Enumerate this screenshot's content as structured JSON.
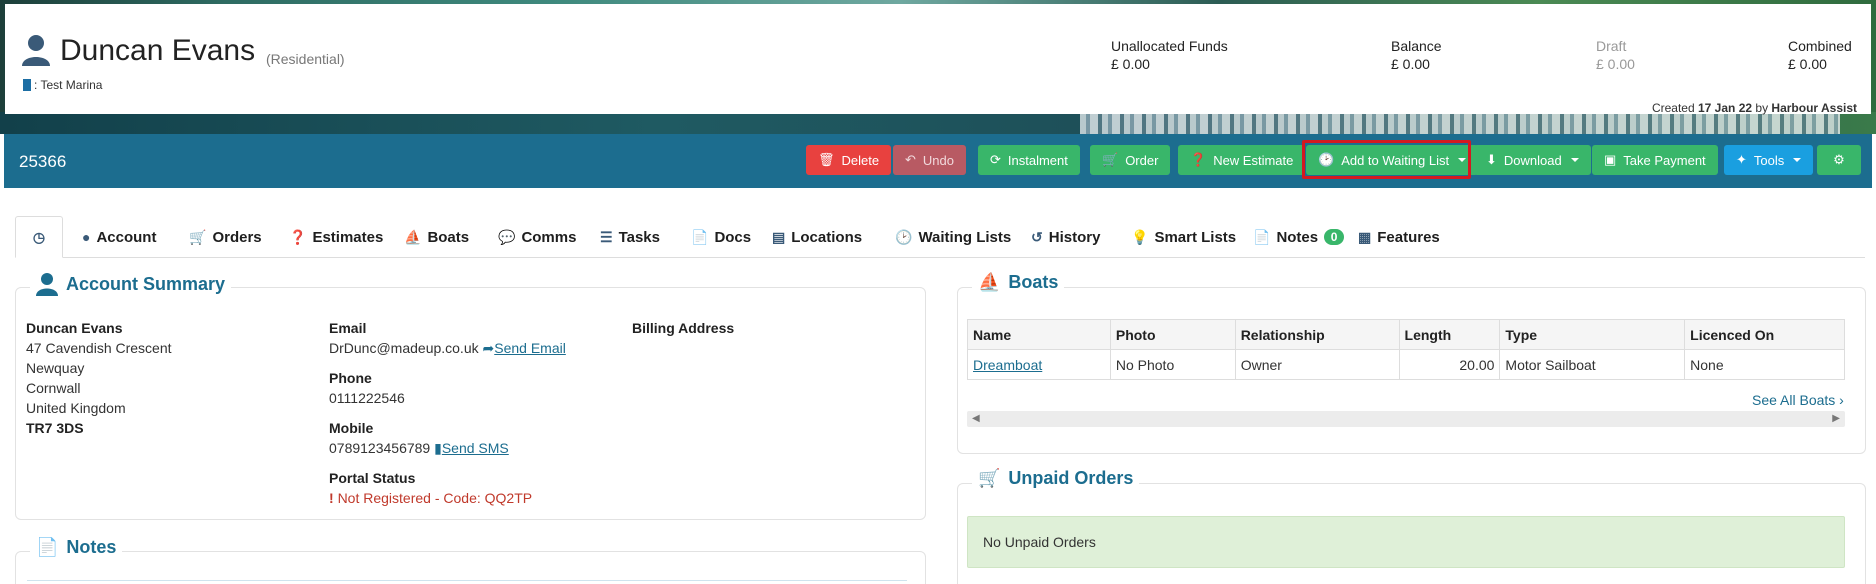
{
  "header": {
    "name": "Duncan Evans",
    "type": "(Residential)",
    "marina": ": Test Marina",
    "funds": [
      {
        "label": "Unallocated Funds",
        "value": "£ 0.00",
        "muted": false
      },
      {
        "label": "Balance",
        "value": "£ 0.00",
        "muted": false
      },
      {
        "label": "Draft",
        "value": "£ 0.00",
        "muted": true
      },
      {
        "label": "Combined",
        "value": "£ 0.00",
        "muted": false
      }
    ],
    "created_prefix": "Created",
    "created_date": "17 Jan 22",
    "created_by_prefix": "by",
    "created_by": "Harbour Assist"
  },
  "toolbar": {
    "record_id": "25366",
    "buttons": {
      "delete": "Delete",
      "undo": "Undo",
      "instalment": "Instalment",
      "order": "Order",
      "new_estimate": "New Estimate",
      "add_waiting_list": "Add to Waiting List",
      "download": "Download",
      "take_payment": "Take Payment",
      "tools": "Tools"
    },
    "colors": {
      "danger": "#e8413f",
      "success": "#39b66a",
      "info": "#1a9fe0",
      "bar": "#1c6d8f"
    }
  },
  "tabs": {
    "account": "Account",
    "orders": "Orders",
    "estimates": "Estimates",
    "boats": "Boats",
    "comms": "Comms",
    "tasks": "Tasks",
    "docs": "Docs",
    "locations": "Locations",
    "waiting_lists": "Waiting Lists",
    "history": "History",
    "smart_lists": "Smart Lists",
    "notes": "Notes",
    "notes_count": "0",
    "features": "Features"
  },
  "account_summary": {
    "title": "Account Summary",
    "address": {
      "name": "Duncan Evans",
      "line1": "47 Cavendish Crescent",
      "line2": "Newquay",
      "line3": "Cornwall",
      "line4": "United Kingdom",
      "postcode": "TR7 3DS"
    },
    "email_label": "Email",
    "email": "DrDunc@madeup.co.uk",
    "send_email": "Send Email",
    "phone_label": "Phone",
    "phone": "0111222546",
    "mobile_label": "Mobile",
    "mobile": "0789123456789",
    "send_sms": "Send SMS",
    "portal_label": "Portal Status",
    "portal_status": "Not Registered - Code: QQ2TP",
    "billing_label": "Billing Address"
  },
  "notes_panel": {
    "title": "Notes"
  },
  "boats_panel": {
    "title": "Boats",
    "columns": [
      "Name",
      "Photo",
      "Relationship",
      "Length",
      "Type",
      "Licenced On"
    ],
    "rows": [
      {
        "name": "Dreamboat",
        "photo": "No Photo",
        "relationship": "Owner",
        "length": "20.00",
        "type": "Motor Sailboat",
        "licenced_on": "None"
      }
    ],
    "see_all": "See All Boats"
  },
  "unpaid_orders": {
    "title": "Unpaid Orders",
    "empty": "No Unpaid Orders"
  }
}
